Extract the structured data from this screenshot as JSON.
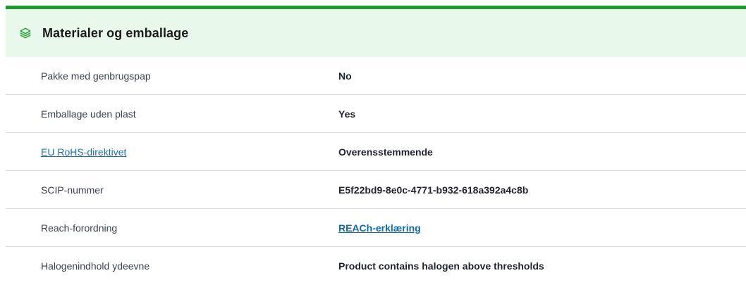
{
  "section": {
    "title": "Materialer og emballage",
    "icon": "layers-icon",
    "accent_color": "#1e9a2f",
    "header_bg": "#e8f8ea"
  },
  "rows": [
    {
      "label": "Pakke med genbrugspap",
      "value": "No"
    },
    {
      "label": "Emballage uden plast",
      "value": "Yes"
    },
    {
      "label": "EU RoHS-direktivet",
      "value": "Overensstemmende"
    },
    {
      "label": "SCIP-nummer",
      "value": "E5f22bd9-8e0c-4771-b932-618a392a4c8b"
    },
    {
      "label": "Reach-forordning",
      "value": "REACh-erklæring"
    },
    {
      "label": "Halogenindhold ydeevne",
      "value": "Product contains halogen above thresholds"
    }
  ]
}
